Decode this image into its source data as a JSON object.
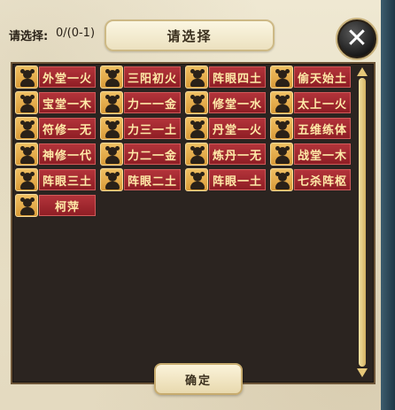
{
  "header": {
    "prompt_label": "请选择:",
    "selection_count": "0/(0-1)",
    "title": "请选择",
    "close_icon": "close-icon"
  },
  "items": [
    {
      "label": "外堂一火"
    },
    {
      "label": "三阳初火"
    },
    {
      "label": "阵眼四土"
    },
    {
      "label": "偷天始土"
    },
    {
      "label": "宝堂一木"
    },
    {
      "label": "力一一金"
    },
    {
      "label": "修堂一水"
    },
    {
      "label": "太上一火"
    },
    {
      "label": "符修一无"
    },
    {
      "label": "力三一土"
    },
    {
      "label": "丹堂一火"
    },
    {
      "label": "五维练体"
    },
    {
      "label": "神修一代"
    },
    {
      "label": "力二一金"
    },
    {
      "label": "炼丹一无"
    },
    {
      "label": "战堂一木"
    },
    {
      "label": "阵眼三土"
    },
    {
      "label": "阵眼二土"
    },
    {
      "label": "阵眼一土"
    },
    {
      "label": "七杀阵枢"
    },
    {
      "label": "柯萍"
    }
  ],
  "footer": {
    "confirm_label": "确定"
  },
  "colors": {
    "name_bg": "#9f262d",
    "name_text": "#ffeaa8",
    "avatar_bg": "#e4a944",
    "panel_bg": "#2b2420"
  }
}
